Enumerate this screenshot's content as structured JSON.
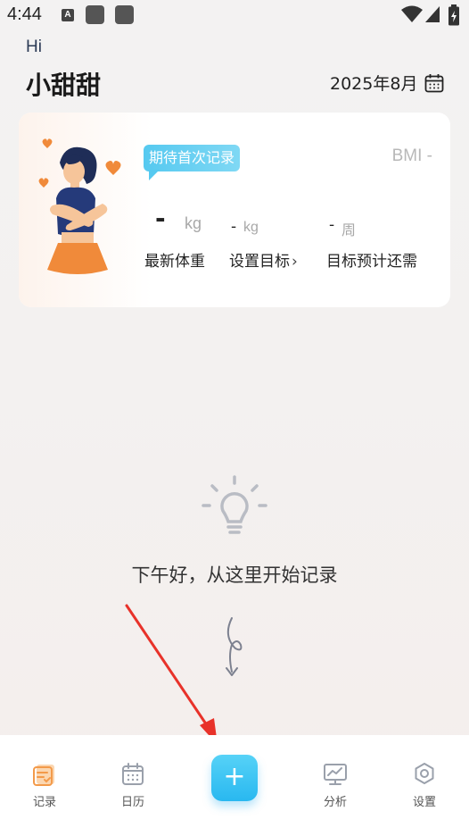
{
  "status_bar": {
    "time": "4:44",
    "notification_letter": "A"
  },
  "header": {
    "greeting": "Hi",
    "username": "小甜甜",
    "date": "2025年8月"
  },
  "card": {
    "badge": "期待首次记录",
    "bmi": "BMI -",
    "weight_value": "-",
    "weight_unit": "kg",
    "goal_value": "-",
    "goal_unit": "kg",
    "weeks_value": "-",
    "weeks_unit": "周",
    "weight_label": "最新体重",
    "goal_label": "设置目标",
    "goal_chevron": "›",
    "weeks_label": "目标预计还需"
  },
  "empty_state": {
    "message": "下午好，从这里开始记录"
  },
  "bottom_nav": {
    "items": [
      {
        "label": "记录",
        "icon": "record-icon"
      },
      {
        "label": "日历",
        "icon": "calendar-icon"
      },
      {
        "label": "分析",
        "icon": "analysis-icon"
      },
      {
        "label": "设置",
        "icon": "settings-icon"
      }
    ],
    "add_label": "+"
  },
  "colors": {
    "accent": "#29b8f0",
    "record_active": "#f39a4a",
    "annotation_arrow": "#e8322a"
  }
}
